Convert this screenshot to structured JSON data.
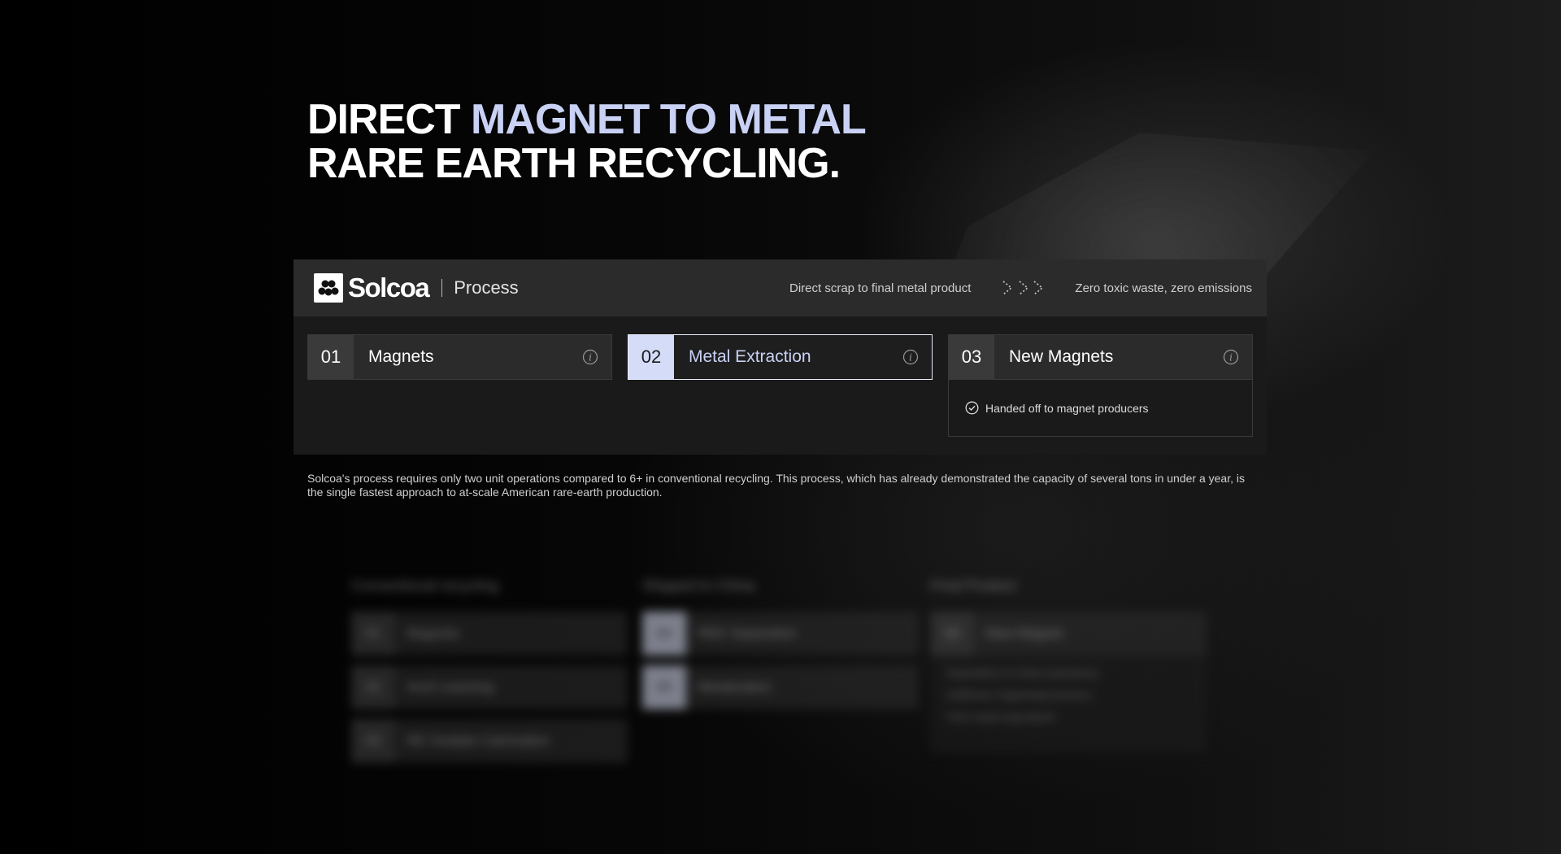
{
  "hero": {
    "line1_prefix": "DIRECT ",
    "line1_accent": "MAGNET TO METAL",
    "line2": "RARE EARTH RECYCLING."
  },
  "header": {
    "brand": "Solcoa",
    "section": "Process",
    "tagline_left": "Direct scrap to final metal product",
    "tagline_right": "Zero toxic waste, zero emissions"
  },
  "steps": [
    {
      "num": "01",
      "label": "Magnets",
      "active": false
    },
    {
      "num": "02",
      "label": "Metal Extraction",
      "active": true
    },
    {
      "num": "03",
      "label": "New Magnets",
      "active": false,
      "detail": "Handed off to magnet producers"
    }
  ],
  "description": "Solcoa's process requires only two unit operations compared to 6+ in conventional recycling. This process, which has already demonstrated the capacity of several tons in under a year, is the single fastest approach to at-scale American rare-earth production.",
  "conventional": {
    "columns": [
      {
        "title": "Conventional recycling",
        "rows": [
          {
            "num": "01",
            "label": "Magnets"
          },
          {
            "num": "02",
            "label": "Acid Leaching"
          },
          {
            "num": "03",
            "label": "RE Oxalate Calcination"
          }
        ]
      },
      {
        "title": "Shipped to China",
        "rows": [
          {
            "num": "04",
            "label": "REE Separation"
          },
          {
            "num": "05",
            "label": "Metalization"
          }
        ]
      },
      {
        "title": "Final Product",
        "rows": [
          {
            "num": "06",
            "label": "New Magnet"
          }
        ],
        "details": [
          "Dependent on China (sanctions)",
          "Inefficient, fragmented process",
          "Toxic waste byproducts"
        ]
      }
    ]
  },
  "colors": {
    "accent": "#c9d2f4",
    "accent_fill": "#d4dcf8",
    "panel": "#1a1a1a",
    "header": "#2b2b2b"
  },
  "icons": {
    "logo": "solcoa-logo-icon",
    "info": "info-icon",
    "check": "check-circle-icon",
    "arrows": "chevron-arrows-icon"
  }
}
